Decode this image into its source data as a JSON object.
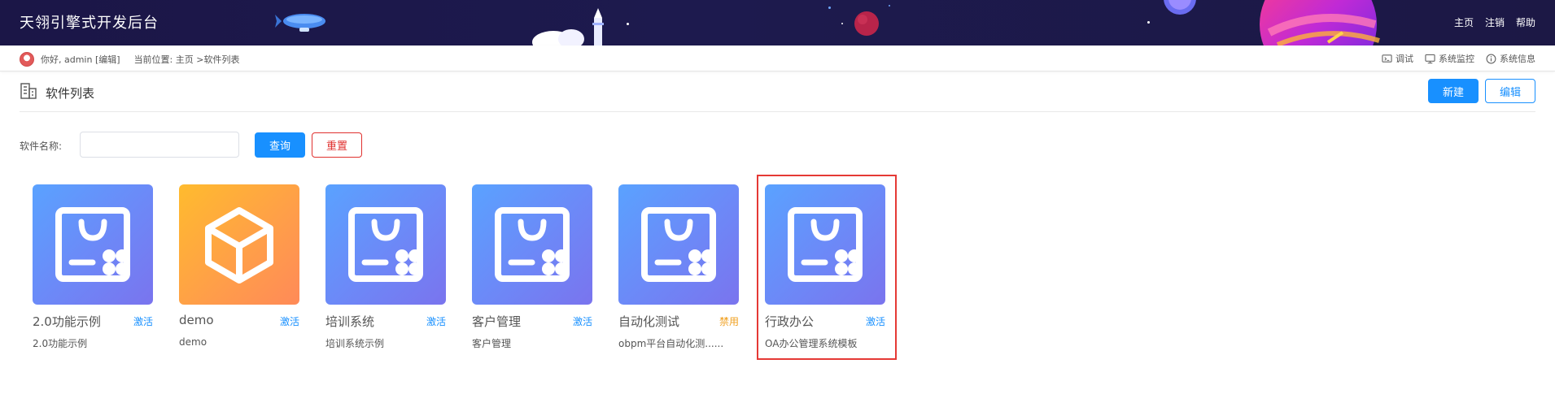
{
  "header": {
    "title": "天翎引擎式开发后台",
    "nav": [
      "主页",
      "注销",
      "帮助"
    ]
  },
  "subbar": {
    "greeting": "你好, admin",
    "edit_link": "[编辑]",
    "location_label": "当前位置:",
    "breadcrumb": "主页 >软件列表",
    "tools": [
      {
        "label": "调试",
        "icon": "debug-icon"
      },
      {
        "label": "系统监控",
        "icon": "monitor-icon"
      },
      {
        "label": "系统信息",
        "icon": "info-icon"
      }
    ]
  },
  "page": {
    "title": "软件列表",
    "new_label": "新建",
    "edit_label": "编辑"
  },
  "filter": {
    "label": "软件名称:",
    "value": "",
    "query_label": "查询",
    "reset_label": "重置"
  },
  "cards": [
    {
      "name": "2.0功能示例",
      "status": "激活",
      "status_kind": "active",
      "desc": "2.0功能示例",
      "icon": "shopping-bag-icon",
      "color": "blue"
    },
    {
      "name": "demo",
      "status": "激活",
      "status_kind": "active",
      "desc": "demo",
      "icon": "cube-icon",
      "color": "orange"
    },
    {
      "name": "培训系统",
      "status": "激活",
      "status_kind": "active",
      "desc": "培训系统示例",
      "icon": "shopping-bag-icon",
      "color": "blue"
    },
    {
      "name": "客户管理",
      "status": "激活",
      "status_kind": "active",
      "desc": "客户管理",
      "icon": "shopping-bag-icon",
      "color": "blue"
    },
    {
      "name": "自动化测试",
      "status": "禁用",
      "status_kind": "disabled",
      "desc": "obpm平台自动化测......",
      "icon": "shopping-bag-icon",
      "color": "blue"
    },
    {
      "name": "行政办公",
      "status": "激活",
      "status_kind": "active",
      "desc": "OA办公管理系统模板",
      "icon": "shopping-bag-icon",
      "color": "blue",
      "highlighted": true
    }
  ],
  "colors": {
    "primary": "#1890ff",
    "danger": "#e0312f",
    "warning": "#f0a020",
    "header_bg": "#1b1647",
    "highlight": "#e53935"
  }
}
